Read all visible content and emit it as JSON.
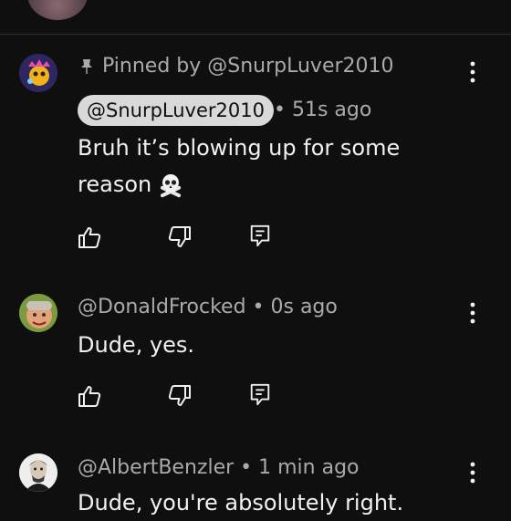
{
  "comments": [
    {
      "pinned_label": "Pinned by @SnurpLuver2010",
      "author": "@SnurpLuver2010",
      "time": "• 51s ago",
      "text": "Bruh it’s blowing up for some reason",
      "emoji": "skull-and-crossbones"
    },
    {
      "author": "@DonaldFrocked",
      "time": " • 0s ago",
      "text": "Dude, yes."
    },
    {
      "author": "@AlbertBenzler",
      "time": " • 1 min ago",
      "text": "Dude, you're absolutely right."
    }
  ],
  "colors": {
    "background": "#0f0f0f",
    "text": "#f1f1f1",
    "meta": "#aaaaaa",
    "chip": "#d9d9d9"
  }
}
